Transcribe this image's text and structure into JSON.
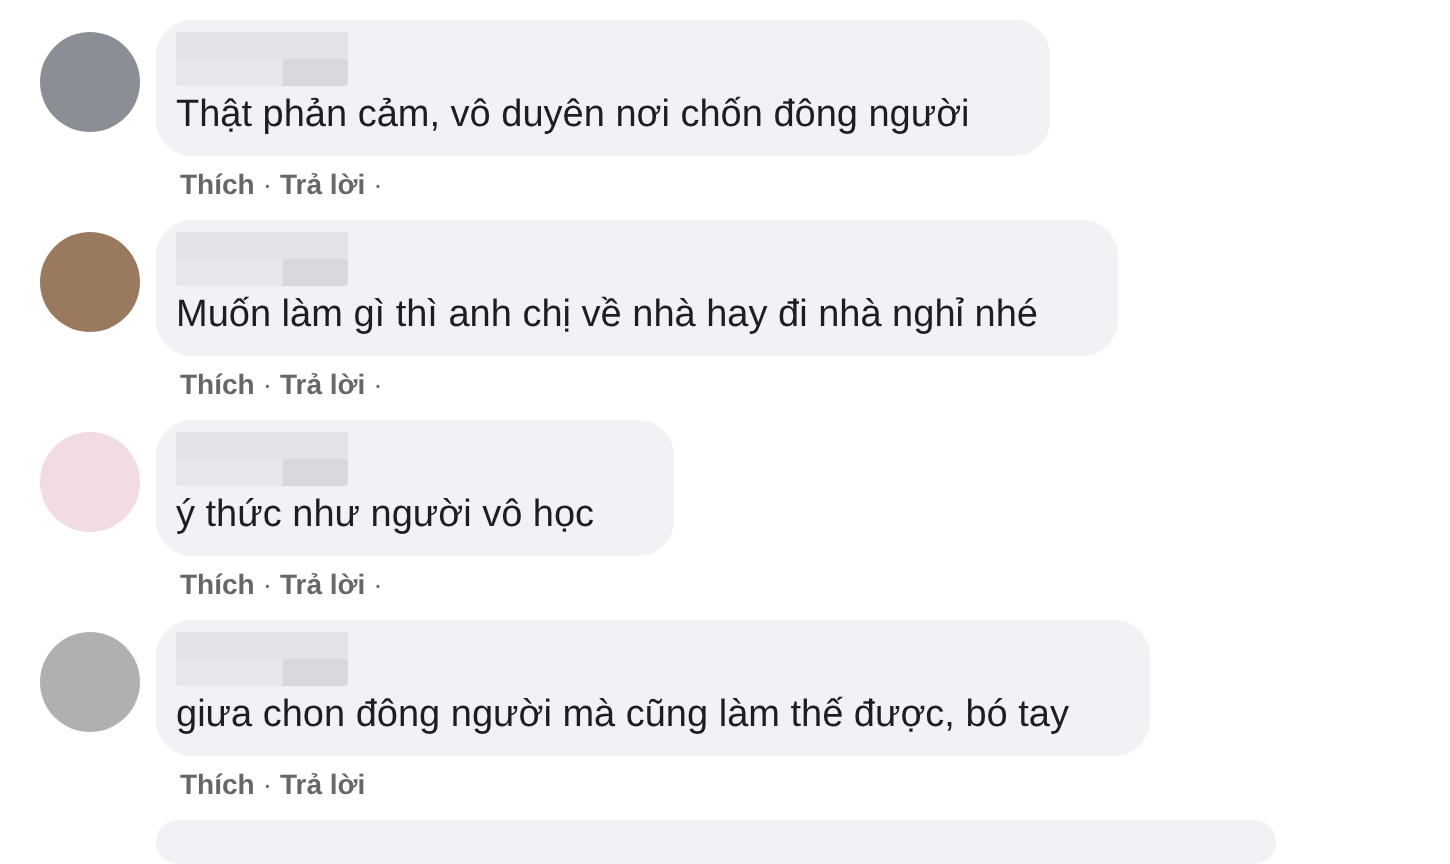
{
  "comments": [
    {
      "text": "Thật phản cảm, vô duyên nơi chốn đông người",
      "actions": [
        {
          "kind": "link",
          "label": "Thích"
        },
        {
          "kind": "dot",
          "label": "·"
        },
        {
          "kind": "link",
          "label": "Trả lời"
        },
        {
          "kind": "dot",
          "label": "·"
        }
      ]
    },
    {
      "text": "Muốn làm gì thì anh chị về nhà hay đi nhà nghỉ nhé",
      "actions": [
        {
          "kind": "link",
          "label": "Thích"
        },
        {
          "kind": "dot",
          "label": "·"
        },
        {
          "kind": "link",
          "label": "Trả lời"
        },
        {
          "kind": "dot",
          "label": "·"
        }
      ]
    },
    {
      "text": "ý thức như người vô học",
      "actions": [
        {
          "kind": "link",
          "label": "Thích"
        },
        {
          "kind": "dot",
          "label": "·"
        },
        {
          "kind": "link",
          "label": "Trả lời"
        },
        {
          "kind": "dot",
          "label": "·"
        }
      ]
    },
    {
      "text": "giưa chon đông người mà cũng làm thế được, bó tay",
      "actions": [
        {
          "kind": "link",
          "label": "Thích"
        },
        {
          "kind": "dot",
          "label": "·"
        },
        {
          "kind": "link",
          "label": "Trả lời"
        }
      ]
    }
  ]
}
